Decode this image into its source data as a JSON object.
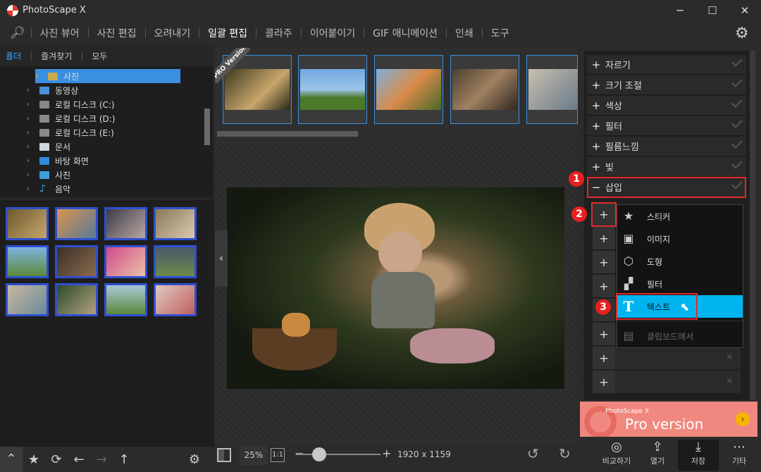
{
  "app": {
    "title": "PhotoScape X",
    "minimize": "─",
    "maximize": "☐",
    "close": "✕"
  },
  "menu": {
    "items": [
      "사진 뷰어",
      "사진 편집",
      "오려내기",
      "일괄 편집",
      "콜라주",
      "이어붙이기",
      "GIF 애니메이션",
      "인쇄",
      "도구"
    ],
    "active_index": 3
  },
  "folder_tabs": [
    "폴더",
    "즐겨찾기",
    "모두"
  ],
  "tree": [
    {
      "label": "사진",
      "icon": "folder-icon",
      "selected": true,
      "color": "#c9a94e"
    },
    {
      "label": "동영상",
      "icon": "video-icon",
      "color": "#4a8fd8"
    },
    {
      "label": "로컬 디스크 (C:)",
      "icon": "drive-icon",
      "color": "#888"
    },
    {
      "label": "로컬 디스크 (D:)",
      "icon": "drive-icon",
      "color": "#888"
    },
    {
      "label": "로컬 디스크 (E:)",
      "icon": "drive-icon",
      "color": "#888"
    },
    {
      "label": "문서",
      "icon": "document-icon",
      "color": "#cfd8e0"
    },
    {
      "label": "바탕 화면",
      "icon": "desktop-icon",
      "color": "#2f8be0"
    },
    {
      "label": "사진",
      "icon": "pictures-icon",
      "color": "#3d9fe0"
    },
    {
      "label": "음악",
      "icon": "music-icon",
      "color": "#3aa3e0"
    }
  ],
  "pro_badge": "PRO Version",
  "zoom": {
    "percent": "25%",
    "fit": "1:1",
    "dimensions": "1920 x 1159",
    "minus": "−",
    "plus": "+"
  },
  "right_menu": [
    {
      "label": "자르기",
      "sign": "+"
    },
    {
      "label": "크기 조절",
      "sign": "+"
    },
    {
      "label": "색상",
      "sign": "+"
    },
    {
      "label": "필터",
      "sign": "+"
    },
    {
      "label": "필름느낌",
      "sign": "+"
    },
    {
      "label": "빛",
      "sign": "+"
    },
    {
      "label": "삽입",
      "sign": "−"
    }
  ],
  "insert_menu": [
    {
      "label": "스티커",
      "icon": "sticker-icon",
      "glyph": "★"
    },
    {
      "label": "이미지",
      "icon": "image-icon",
      "glyph": "▣"
    },
    {
      "label": "도형",
      "icon": "shape-icon",
      "glyph": "⬡"
    },
    {
      "label": "필터",
      "icon": "filter-icon",
      "glyph": "▞"
    },
    {
      "label": "텍스트",
      "icon": "text-icon",
      "glyph": "T",
      "selected": true
    },
    {
      "label": "클립보드에서",
      "icon": "clipboard-icon",
      "glyph": "▤",
      "disabled": true
    }
  ],
  "callouts": [
    "1",
    "2",
    "3"
  ],
  "promo": {
    "small": "PhotoScape X",
    "big": "Pro version",
    "go": "›"
  },
  "bottom_right": [
    {
      "label": "비교하기",
      "icon": "compare-icon",
      "glyph": "◎"
    },
    {
      "label": "열기",
      "icon": "open-icon",
      "glyph": "⇪"
    },
    {
      "label": "저장",
      "icon": "save-icon",
      "glyph": "⤓",
      "active": true
    },
    {
      "label": "기타",
      "icon": "more-icon",
      "glyph": "⋯"
    }
  ],
  "plus": "+",
  "x_mark": "✕"
}
